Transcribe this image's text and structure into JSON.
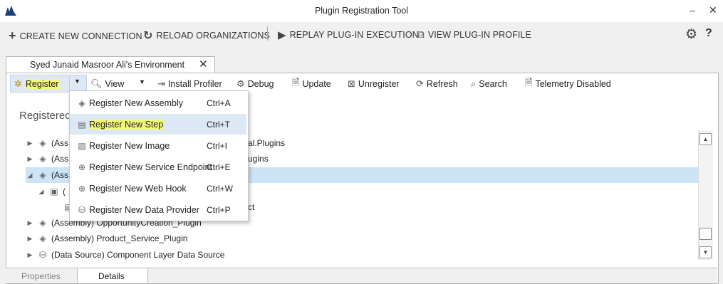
{
  "window": {
    "title": "Plugin Registration Tool",
    "minimize": "–",
    "close": "✕"
  },
  "commandbar": {
    "create": "CREATE NEW CONNECTION",
    "reload": "RELOAD ORGANIZATIONS",
    "replay": "REPLAY PLUG-IN EXECUTION",
    "profile": "VIEW PLUG-IN PROFILE",
    "settings_icon": "⚙",
    "help": "?"
  },
  "tab": {
    "label": "Syed Junaid Masroor Ali's Environment",
    "close": "✕"
  },
  "toolbar": {
    "register": "Register",
    "view": "View",
    "install_profiler": "Install Profiler",
    "debug": "Debug",
    "update": "Update",
    "unregister": "Unregister",
    "refresh": "Refresh",
    "search": "Search",
    "telemetry": "Telemetry Disabled"
  },
  "tree": {
    "heading": "Registered",
    "rows": [
      {
        "label": "(Ass",
        "suffix": "al.Plugins"
      },
      {
        "label": "(Ass",
        "suffix": "ugins"
      },
      {
        "label": "(Ass",
        "suffix": ""
      },
      {
        "label": "(",
        "suffix": ""
      },
      {
        "label": "",
        "suffix": "ct"
      },
      {
        "label": "(Assembly) OpportunityCreation_Plugin"
      },
      {
        "label": "(Assembly) Product_Service_Plugin"
      },
      {
        "label": "(Data Source) Component Layer Data Source"
      }
    ]
  },
  "menu": {
    "items": [
      {
        "label": "Register New Assembly",
        "shortcut": "Ctrl+A"
      },
      {
        "label": "Register New Step",
        "shortcut": "Ctrl+T"
      },
      {
        "label": "Register New Image",
        "shortcut": "Ctrl+I"
      },
      {
        "label": "Register New Service Endpoint",
        "shortcut": "Ctrl+E"
      },
      {
        "label": "Register New Web Hook",
        "shortcut": "Ctrl+W"
      },
      {
        "label": "Register New Data Provider",
        "shortcut": "Ctrl+P"
      }
    ]
  },
  "bottom_tabs": {
    "properties": "Properties",
    "details": "Details"
  },
  "colors": {
    "highlight": "#f3f77a",
    "selection": "#cde4f7",
    "menu_hover": "#dde8f5"
  }
}
